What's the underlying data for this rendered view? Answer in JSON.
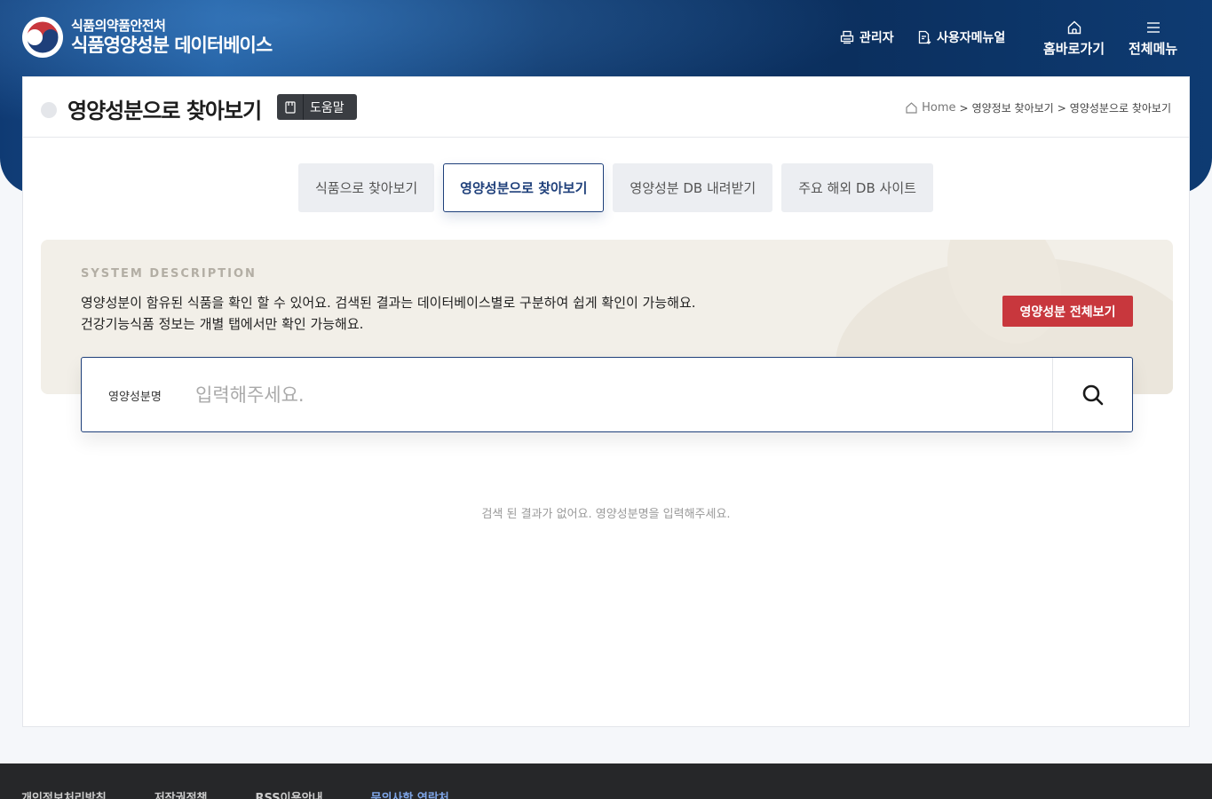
{
  "header": {
    "agency": "식품의약품안전처",
    "site_name": "식품영양성분 데이터베이스",
    "admin_label": "관리자",
    "manual_label": "사용자메뉴얼",
    "home_label": "홈바로가기",
    "menu_label": "전체메뉴"
  },
  "page": {
    "title": "영양성분으로 찾아보기",
    "help_label": "도움말",
    "breadcrumb": [
      "Home",
      ">",
      "영양정보 찾아보기",
      ">",
      "영양성분으로 찾아보기"
    ]
  },
  "tabs": [
    {
      "label": "식품으로 찾아보기",
      "active": false
    },
    {
      "label": "영양성분으로 찾아보기",
      "active": true
    },
    {
      "label": "영양성분 DB 내려받기",
      "active": false
    },
    {
      "label": "주요 해외 DB 사이트",
      "active": false
    }
  ],
  "description": {
    "eyebrow": "SYSTEM DESCRIPTION",
    "line1": "영양성분이 함유된 식품을 확인 할 수 있어요. 검색된 결과는 데이터베이스별로 구분하여 쉽게 확인이 가능해요.",
    "line2": "건강기능식품 정보는 개별 탭에서만 확인 가능해요.",
    "view_all_label": "영양성분 전체보기"
  },
  "search": {
    "label": "영양성분명",
    "placeholder": "입력해주세요.",
    "value": ""
  },
  "results": {
    "empty_message": "검색 된 결과가 없어요. 영양성분명을 입력해주세요."
  },
  "footer": {
    "links": [
      "개인정보처리방침",
      "저작권정책",
      "RSS이용안내",
      "문의사항 연락처"
    ]
  },
  "colors": {
    "brand_navy": "#1e3f7a",
    "accent_red": "#c8373d",
    "description_bg": "#f2efe8",
    "footer_bg": "#262729"
  }
}
